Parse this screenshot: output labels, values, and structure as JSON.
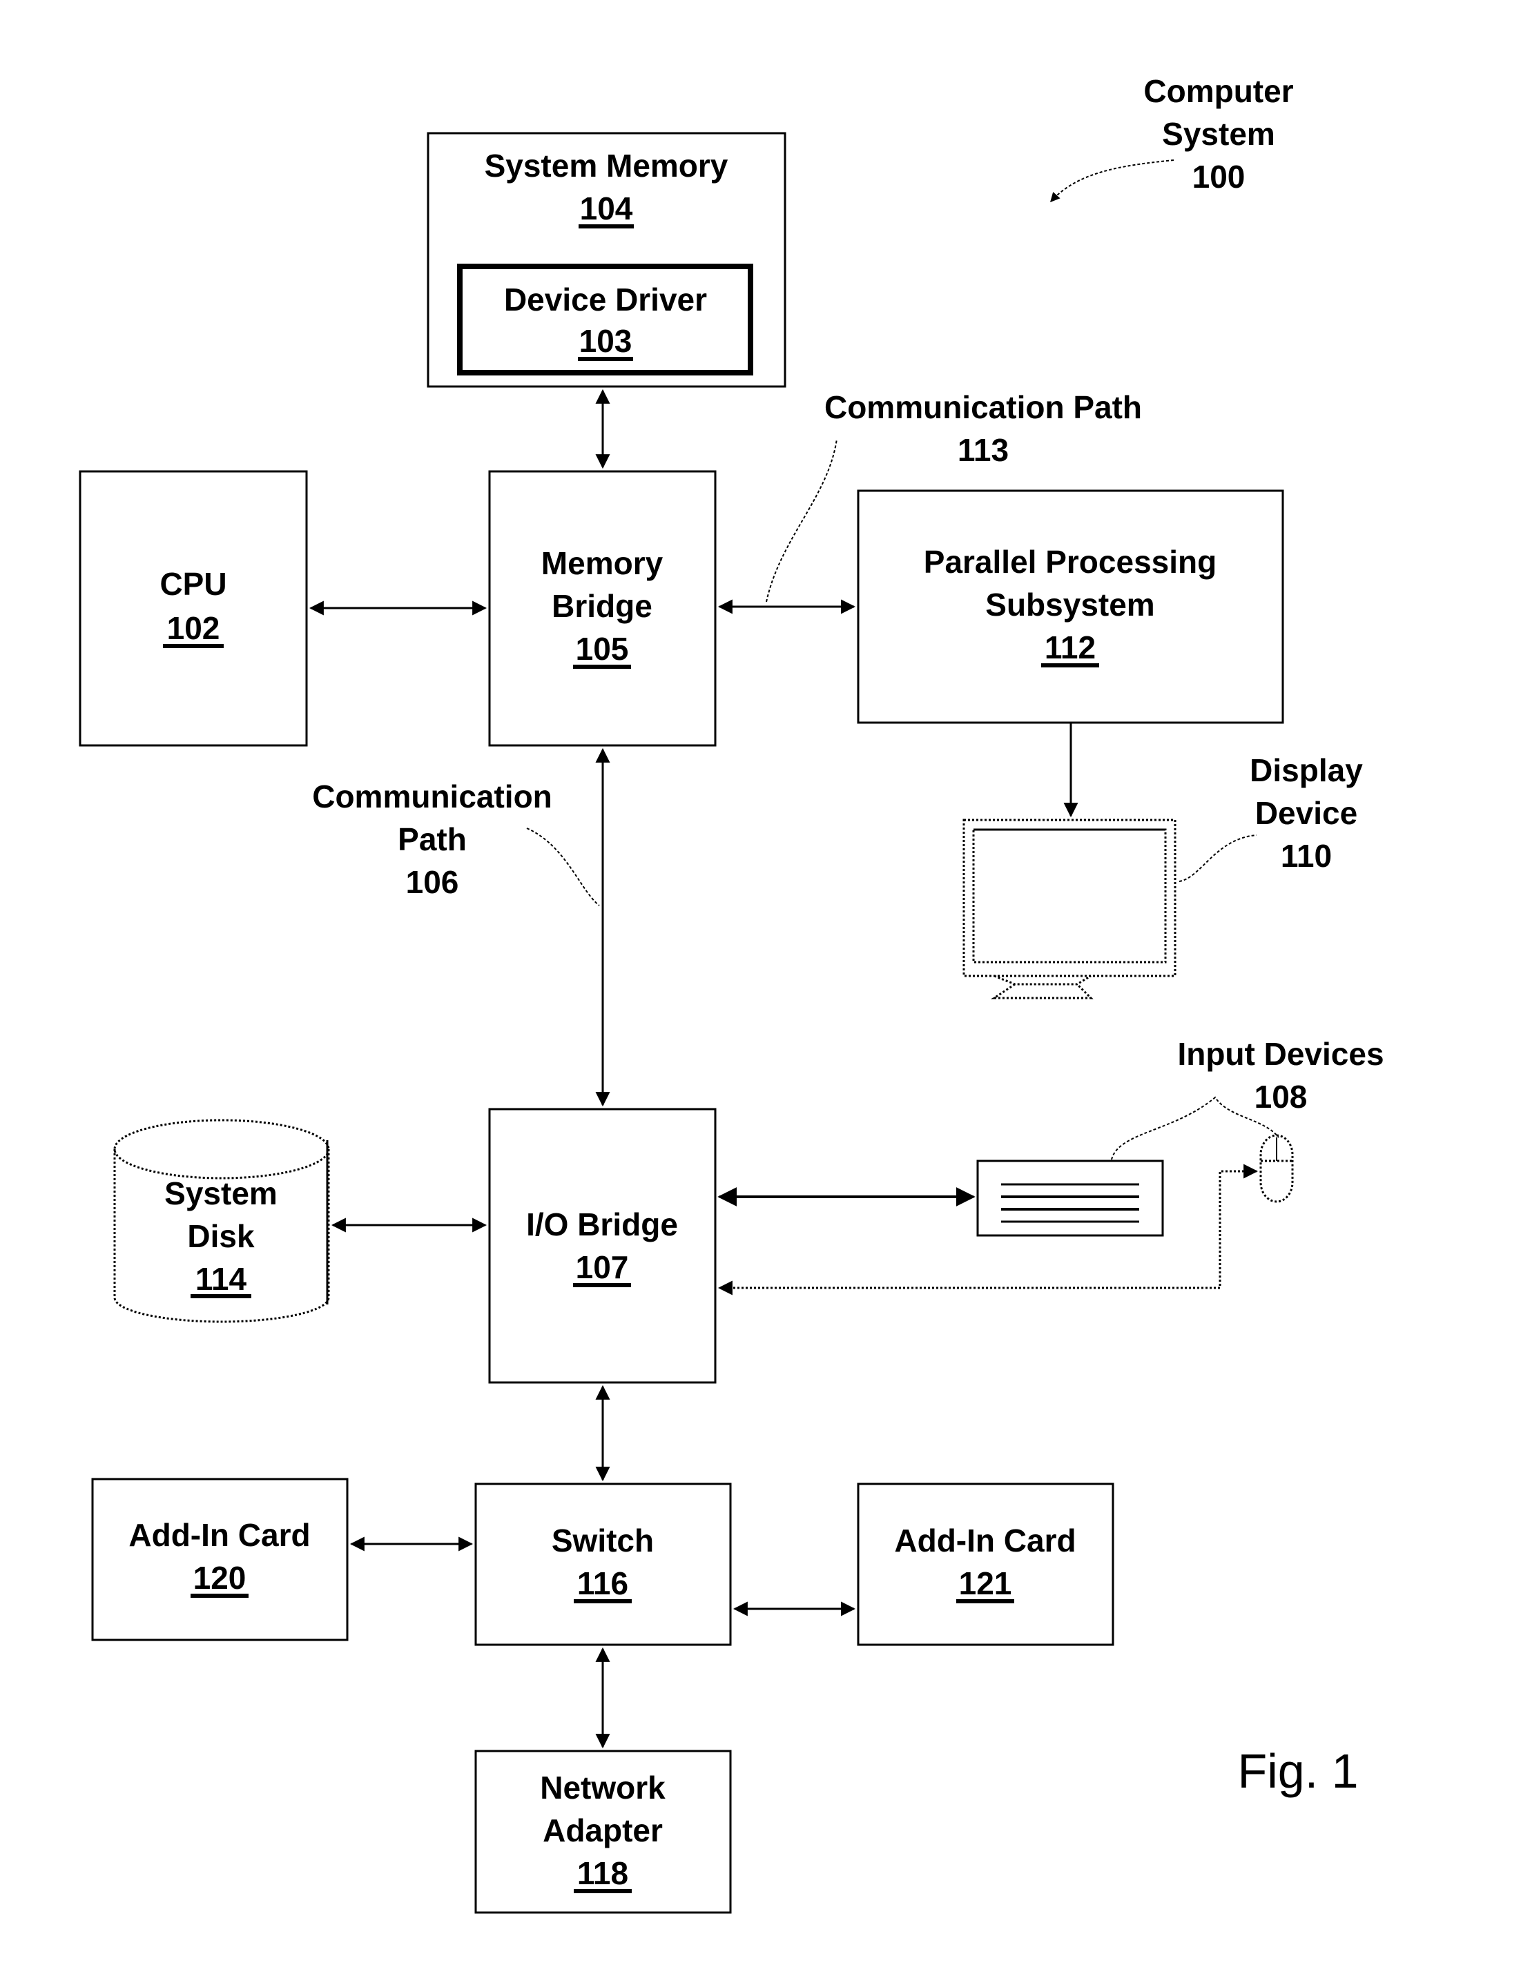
{
  "figure": {
    "caption": "Fig. 1",
    "system_label": [
      "Computer",
      "System",
      "100"
    ]
  },
  "blocks": {
    "system_memory": {
      "lines": [
        "System Memory"
      ],
      "ref": "104"
    },
    "device_driver": {
      "lines": [
        "Device Driver"
      ],
      "ref": "103"
    },
    "cpu": {
      "lines": [
        "CPU"
      ],
      "ref": "102"
    },
    "memory_bridge": {
      "lines": [
        "Memory",
        "Bridge"
      ],
      "ref": "105"
    },
    "parallel_processing": {
      "lines": [
        "Parallel Processing",
        "Subsystem"
      ],
      "ref": "112"
    },
    "io_bridge": {
      "lines": [
        "I/O Bridge"
      ],
      "ref": "107"
    },
    "system_disk": {
      "lines": [
        "System",
        "Disk"
      ],
      "ref": "114"
    },
    "switch": {
      "lines": [
        "Switch"
      ],
      "ref": "116"
    },
    "add_in_card_120": {
      "lines": [
        "Add-In Card"
      ],
      "ref": "120"
    },
    "add_in_card_121": {
      "lines": [
        "Add-In Card"
      ],
      "ref": "121"
    },
    "network_adapter": {
      "lines": [
        "Network",
        "Adapter"
      ],
      "ref": "118"
    }
  },
  "callouts": {
    "comm_path_113": [
      "Communication Path",
      "113"
    ],
    "comm_path_106": [
      "Communication",
      "Path",
      "106"
    ],
    "display_device": [
      "Display",
      "Device",
      "110"
    ],
    "input_devices": [
      "Input Devices",
      "108"
    ]
  }
}
